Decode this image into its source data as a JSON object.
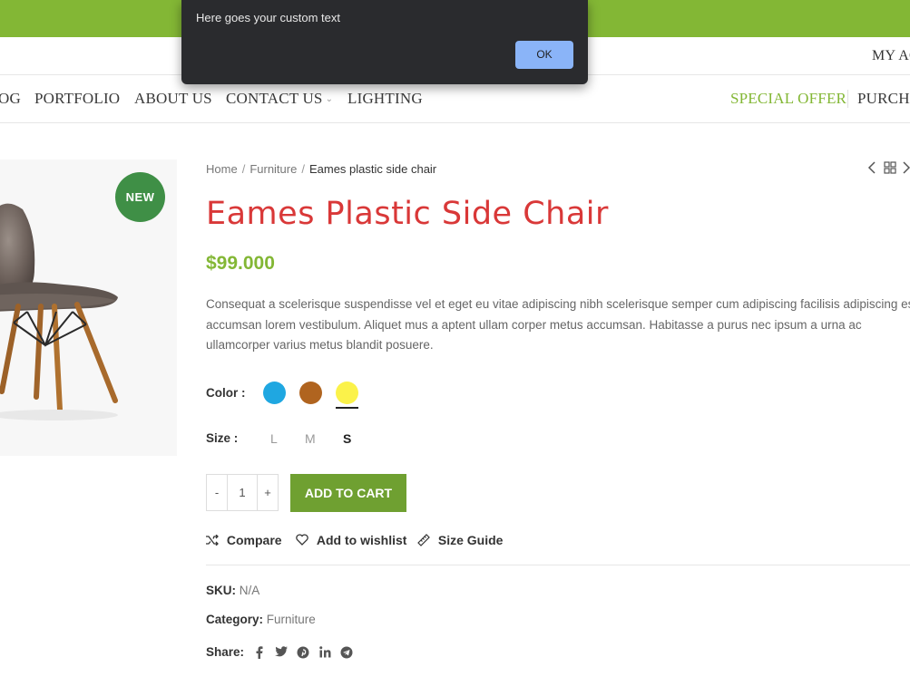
{
  "alert": {
    "message": "Here goes your custom text",
    "ok_label": "OK"
  },
  "header": {
    "account_label": "MY AC"
  },
  "nav": {
    "items": [
      {
        "label": "OG"
      },
      {
        "label": "PORTFOLIO"
      },
      {
        "label": "ABOUT US"
      },
      {
        "label": "CONTACT US"
      },
      {
        "label": "LIGHTING"
      }
    ],
    "special_offer": "SPECIAL OFFER",
    "purchase": "PURCHA"
  },
  "product": {
    "badge": "NEW",
    "breadcrumb": {
      "home": "Home",
      "category": "Furniture",
      "current": "Eames plastic side chair"
    },
    "title": "Eames Plastic Side Chair",
    "price": "$99.000",
    "description": "Consequat a scelerisque suspendisse vel et eget eu vitae adipiscing nibh scelerisque semper cum adipiscing facilisis adipiscing est accumsan lorem vestibulum. Aliquet mus a aptent ullam corper metus accumsan. Habitasse a purus nec ipsum a urna ac ullamcorper varius metus blandit posuere.",
    "color_label": "Color :",
    "colors": [
      {
        "name": "blue",
        "hex": "#1fa7e1"
      },
      {
        "name": "brown",
        "hex": "#b0641f"
      },
      {
        "name": "yellow",
        "hex": "#fbf24a",
        "selected": true
      }
    ],
    "size_label": "Size :",
    "sizes": [
      {
        "label": "L"
      },
      {
        "label": "M"
      },
      {
        "label": "S",
        "selected": true
      }
    ],
    "quantity": {
      "minus": "-",
      "value": "1",
      "plus": "+"
    },
    "add_to_cart": "ADD TO CART",
    "actions": {
      "compare": "Compare",
      "wishlist": "Add to wishlist",
      "size_guide": "Size Guide"
    },
    "sku_label": "SKU:",
    "sku_value": "N/A",
    "category_label": "Category:",
    "category_value": "Furniture",
    "share_label": "Share:",
    "share_icons": [
      "facebook-icon",
      "twitter-icon",
      "pinterest-icon",
      "linkedin-icon",
      "telegram-icon"
    ]
  },
  "colors": {
    "brand_green": "#83b735",
    "button_green": "#6fa031",
    "title_red": "#d93838",
    "badge_green": "#3f8f46"
  }
}
